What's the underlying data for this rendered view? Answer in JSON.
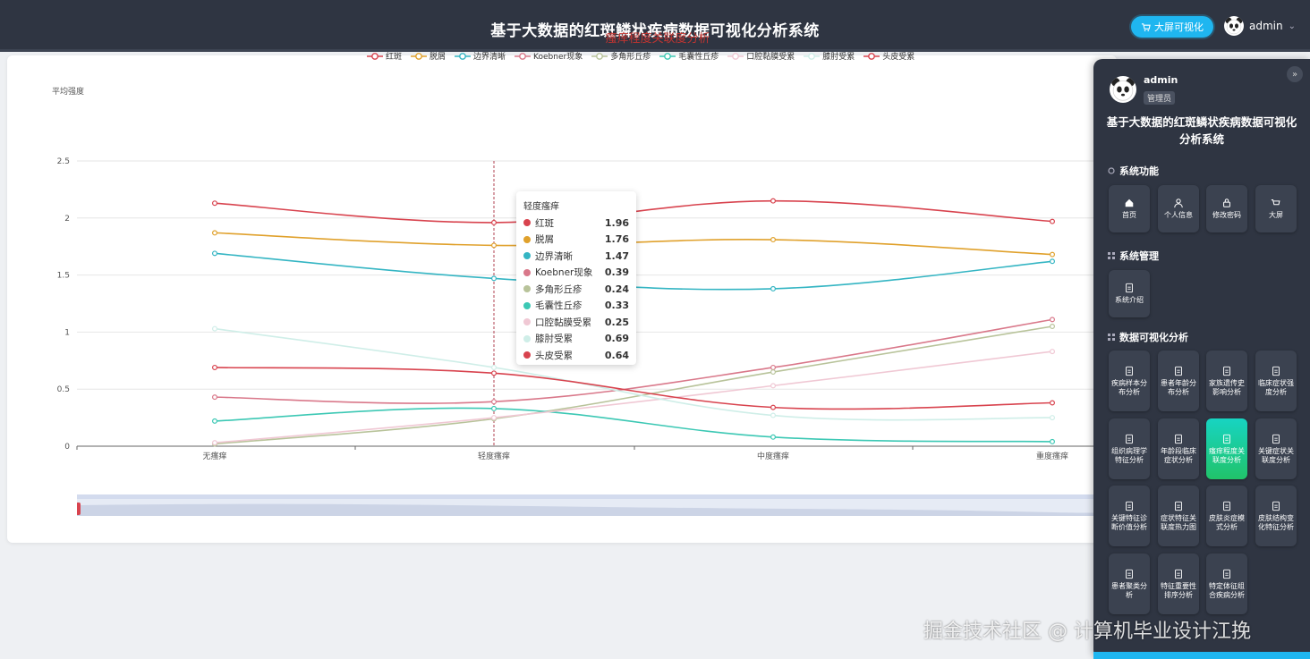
{
  "header": {
    "title": "基于大数据的红斑鳞状疾病数据可视化分析系统",
    "big_screen_button": "大屏可视化",
    "username": "admin"
  },
  "chart_panel": {
    "title": "瘙痒程度关联度分析",
    "y_label": "平均强度"
  },
  "tooltip": {
    "title": "轻度瘙痒",
    "rows": [
      {
        "name": "红斑",
        "value": "1.96",
        "color": "#d8434e"
      },
      {
        "name": "脱屑",
        "value": "1.76",
        "color": "#e0a12c"
      },
      {
        "name": "边界清晰",
        "value": "1.47",
        "color": "#34b5c3"
      },
      {
        "name": "Koebner现象",
        "value": "0.39",
        "color": "#d9788a"
      },
      {
        "name": "多角形丘疹",
        "value": "0.24",
        "color": "#b8c39a"
      },
      {
        "name": "毛囊性丘疹",
        "value": "0.33",
        "color": "#3cc8b4"
      },
      {
        "name": "口腔黏膜受累",
        "value": "0.25",
        "color": "#f0c8d4"
      },
      {
        "name": "膝肘受累",
        "value": "0.69",
        "color": "#cfeee8"
      },
      {
        "name": "头皮受累",
        "value": "0.64",
        "color": "#d8434e"
      }
    ]
  },
  "chart_data": {
    "type": "line",
    "title": "瘙痒程度关联度分析",
    "ylabel": "平均强度",
    "categories": [
      "无瘙痒",
      "轻度瘙痒",
      "中度瘙痒",
      "重度瘙痒"
    ],
    "ylim": [
      0,
      2.5
    ],
    "yticks": [
      "0",
      "0.5",
      "1",
      "1.5",
      "2",
      "2.5"
    ],
    "grid": true,
    "legend": "top",
    "series": [
      {
        "name": "红斑",
        "color": "#d8434e",
        "values": [
          2.13,
          1.96,
          2.15,
          1.97
        ]
      },
      {
        "name": "脱屑",
        "color": "#e0a12c",
        "values": [
          1.87,
          1.76,
          1.81,
          1.68
        ]
      },
      {
        "name": "边界清晰",
        "color": "#34b5c3",
        "values": [
          1.69,
          1.47,
          1.38,
          1.62
        ]
      },
      {
        "name": "Koebner现象",
        "color": "#d9788a",
        "values": [
          0.43,
          0.39,
          0.69,
          1.11
        ]
      },
      {
        "name": "多角形丘疹",
        "color": "#b8c39a",
        "values": [
          0.02,
          0.24,
          0.65,
          1.05
        ]
      },
      {
        "name": "毛囊性丘疹",
        "color": "#3cc8b4",
        "values": [
          0.22,
          0.33,
          0.08,
          0.04
        ]
      },
      {
        "name": "口腔黏膜受累",
        "color": "#f0c8d4",
        "values": [
          0.03,
          0.25,
          0.53,
          0.83
        ]
      },
      {
        "name": "膝肘受累",
        "color": "#cfeee8",
        "values": [
          1.03,
          0.69,
          0.27,
          0.25
        ]
      },
      {
        "name": "头皮受累",
        "color": "#d8434e",
        "values": [
          0.69,
          0.64,
          0.34,
          0.38
        ]
      }
    ]
  },
  "drawer": {
    "username": "admin",
    "role": "管理员",
    "title_line1": "基于大数据的红斑鳞状疾病数据可视化",
    "title_line2": "分析系统",
    "section_system": "系统功能",
    "system_items": [
      {
        "label": "首页",
        "icon": "home-icon"
      },
      {
        "label": "个人信息",
        "icon": "user-icon"
      },
      {
        "label": "修改密码",
        "icon": "lock-icon"
      },
      {
        "label": "大屏",
        "icon": "screen-icon"
      }
    ],
    "section_manage": "系统管理",
    "manage_items": [
      {
        "label": "系统介绍",
        "icon": "document-icon"
      }
    ],
    "section_viz": "数据可视化分析",
    "viz_items": [
      {
        "label": "疾病样本分布分析"
      },
      {
        "label": "患者年龄分布分析"
      },
      {
        "label": "家族遗传史影响分析"
      },
      {
        "label": "临床症状强度分析"
      },
      {
        "label": "组织病理学特征分析"
      },
      {
        "label": "年龄段临床症状分析"
      },
      {
        "label": "瘙痒程度关联度分析",
        "active": true
      },
      {
        "label": "关键症状关联度分析"
      },
      {
        "label": "关键特征诊断价值分析"
      },
      {
        "label": "症状特征关联度热力图"
      },
      {
        "label": "皮肤炎症模式分析"
      },
      {
        "label": "皮肤结构变化特征分析"
      },
      {
        "label": "患者聚类分析"
      },
      {
        "label": "特征重要性排序分析"
      },
      {
        "label": "特定体征组合疾病分析"
      }
    ]
  },
  "watermark": "掘金技术社区 @ 计算机毕业设计江挽"
}
